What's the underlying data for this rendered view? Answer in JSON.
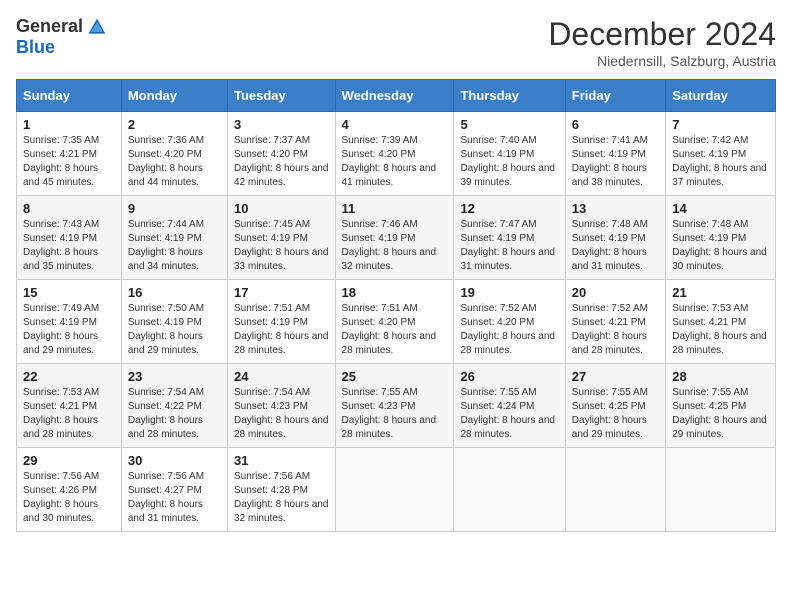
{
  "header": {
    "logo_general": "General",
    "logo_blue": "Blue",
    "title": "December 2024",
    "subtitle": "Niedernsill, Salzburg, Austria"
  },
  "columns": [
    "Sunday",
    "Monday",
    "Tuesday",
    "Wednesday",
    "Thursday",
    "Friday",
    "Saturday"
  ],
  "weeks": [
    [
      {
        "day": "1",
        "sunrise": "Sunrise: 7:35 AM",
        "sunset": "Sunset: 4:21 PM",
        "daylight": "Daylight: 8 hours and 45 minutes."
      },
      {
        "day": "2",
        "sunrise": "Sunrise: 7:36 AM",
        "sunset": "Sunset: 4:20 PM",
        "daylight": "Daylight: 8 hours and 44 minutes."
      },
      {
        "day": "3",
        "sunrise": "Sunrise: 7:37 AM",
        "sunset": "Sunset: 4:20 PM",
        "daylight": "Daylight: 8 hours and 42 minutes."
      },
      {
        "day": "4",
        "sunrise": "Sunrise: 7:39 AM",
        "sunset": "Sunset: 4:20 PM",
        "daylight": "Daylight: 8 hours and 41 minutes."
      },
      {
        "day": "5",
        "sunrise": "Sunrise: 7:40 AM",
        "sunset": "Sunset: 4:19 PM",
        "daylight": "Daylight: 8 hours and 39 minutes."
      },
      {
        "day": "6",
        "sunrise": "Sunrise: 7:41 AM",
        "sunset": "Sunset: 4:19 PM",
        "daylight": "Daylight: 8 hours and 38 minutes."
      },
      {
        "day": "7",
        "sunrise": "Sunrise: 7:42 AM",
        "sunset": "Sunset: 4:19 PM",
        "daylight": "Daylight: 8 hours and 37 minutes."
      }
    ],
    [
      {
        "day": "8",
        "sunrise": "Sunrise: 7:43 AM",
        "sunset": "Sunset: 4:19 PM",
        "daylight": "Daylight: 8 hours and 35 minutes."
      },
      {
        "day": "9",
        "sunrise": "Sunrise: 7:44 AM",
        "sunset": "Sunset: 4:19 PM",
        "daylight": "Daylight: 8 hours and 34 minutes."
      },
      {
        "day": "10",
        "sunrise": "Sunrise: 7:45 AM",
        "sunset": "Sunset: 4:19 PM",
        "daylight": "Daylight: 8 hours and 33 minutes."
      },
      {
        "day": "11",
        "sunrise": "Sunrise: 7:46 AM",
        "sunset": "Sunset: 4:19 PM",
        "daylight": "Daylight: 8 hours and 32 minutes."
      },
      {
        "day": "12",
        "sunrise": "Sunrise: 7:47 AM",
        "sunset": "Sunset: 4:19 PM",
        "daylight": "Daylight: 8 hours and 31 minutes."
      },
      {
        "day": "13",
        "sunrise": "Sunrise: 7:48 AM",
        "sunset": "Sunset: 4:19 PM",
        "daylight": "Daylight: 8 hours and 31 minutes."
      },
      {
        "day": "14",
        "sunrise": "Sunrise: 7:48 AM",
        "sunset": "Sunset: 4:19 PM",
        "daylight": "Daylight: 8 hours and 30 minutes."
      }
    ],
    [
      {
        "day": "15",
        "sunrise": "Sunrise: 7:49 AM",
        "sunset": "Sunset: 4:19 PM",
        "daylight": "Daylight: 8 hours and 29 minutes."
      },
      {
        "day": "16",
        "sunrise": "Sunrise: 7:50 AM",
        "sunset": "Sunset: 4:19 PM",
        "daylight": "Daylight: 8 hours and 29 minutes."
      },
      {
        "day": "17",
        "sunrise": "Sunrise: 7:51 AM",
        "sunset": "Sunset: 4:19 PM",
        "daylight": "Daylight: 8 hours and 28 minutes."
      },
      {
        "day": "18",
        "sunrise": "Sunrise: 7:51 AM",
        "sunset": "Sunset: 4:20 PM",
        "daylight": "Daylight: 8 hours and 28 minutes."
      },
      {
        "day": "19",
        "sunrise": "Sunrise: 7:52 AM",
        "sunset": "Sunset: 4:20 PM",
        "daylight": "Daylight: 8 hours and 28 minutes."
      },
      {
        "day": "20",
        "sunrise": "Sunrise: 7:52 AM",
        "sunset": "Sunset: 4:21 PM",
        "daylight": "Daylight: 8 hours and 28 minutes."
      },
      {
        "day": "21",
        "sunrise": "Sunrise: 7:53 AM",
        "sunset": "Sunset: 4:21 PM",
        "daylight": "Daylight: 8 hours and 28 minutes."
      }
    ],
    [
      {
        "day": "22",
        "sunrise": "Sunrise: 7:53 AM",
        "sunset": "Sunset: 4:21 PM",
        "daylight": "Daylight: 8 hours and 28 minutes."
      },
      {
        "day": "23",
        "sunrise": "Sunrise: 7:54 AM",
        "sunset": "Sunset: 4:22 PM",
        "daylight": "Daylight: 8 hours and 28 minutes."
      },
      {
        "day": "24",
        "sunrise": "Sunrise: 7:54 AM",
        "sunset": "Sunset: 4:23 PM",
        "daylight": "Daylight: 8 hours and 28 minutes."
      },
      {
        "day": "25",
        "sunrise": "Sunrise: 7:55 AM",
        "sunset": "Sunset: 4:23 PM",
        "daylight": "Daylight: 8 hours and 28 minutes."
      },
      {
        "day": "26",
        "sunrise": "Sunrise: 7:55 AM",
        "sunset": "Sunset: 4:24 PM",
        "daylight": "Daylight: 8 hours and 28 minutes."
      },
      {
        "day": "27",
        "sunrise": "Sunrise: 7:55 AM",
        "sunset": "Sunset: 4:25 PM",
        "daylight": "Daylight: 8 hours and 29 minutes."
      },
      {
        "day": "28",
        "sunrise": "Sunrise: 7:55 AM",
        "sunset": "Sunset: 4:25 PM",
        "daylight": "Daylight: 8 hours and 29 minutes."
      }
    ],
    [
      {
        "day": "29",
        "sunrise": "Sunrise: 7:56 AM",
        "sunset": "Sunset: 4:26 PM",
        "daylight": "Daylight: 8 hours and 30 minutes."
      },
      {
        "day": "30",
        "sunrise": "Sunrise: 7:56 AM",
        "sunset": "Sunset: 4:27 PM",
        "daylight": "Daylight: 8 hours and 31 minutes."
      },
      {
        "day": "31",
        "sunrise": "Sunrise: 7:56 AM",
        "sunset": "Sunset: 4:28 PM",
        "daylight": "Daylight: 8 hours and 32 minutes."
      },
      {
        "day": "",
        "sunrise": "",
        "sunset": "",
        "daylight": ""
      },
      {
        "day": "",
        "sunrise": "",
        "sunset": "",
        "daylight": ""
      },
      {
        "day": "",
        "sunrise": "",
        "sunset": "",
        "daylight": ""
      },
      {
        "day": "",
        "sunrise": "",
        "sunset": "",
        "daylight": ""
      }
    ]
  ]
}
